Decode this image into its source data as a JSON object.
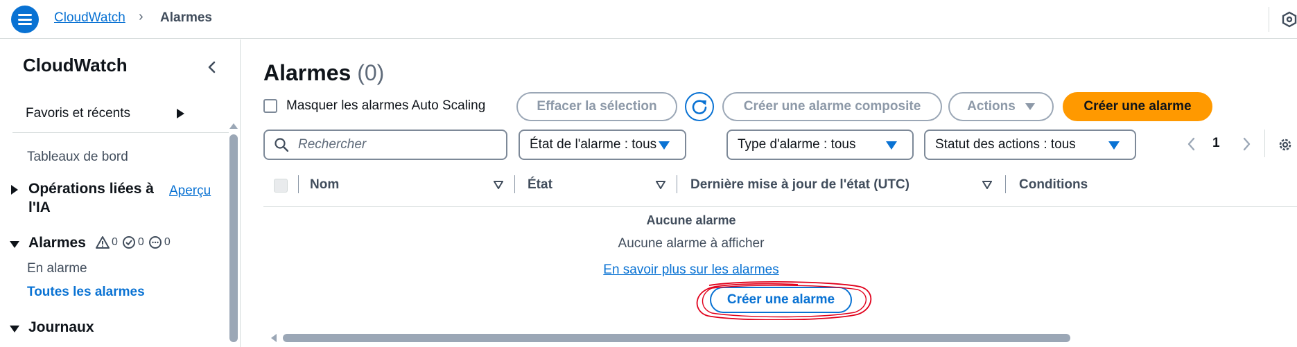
{
  "header": {
    "breadcrumb_service": "CloudWatch",
    "breadcrumb_current": "Alarmes"
  },
  "sidebar": {
    "title": "CloudWatch",
    "favorites": "Favoris et récents",
    "dashboards": "Tableaux de bord",
    "ai_ops_line1": "Opérations liées à",
    "ai_ops_line2": "l'IA",
    "ai_ops_link": "Aperçu",
    "alarms": "Alarmes",
    "alarm_counts": {
      "in_alarm": "0",
      "ok": "0",
      "insufficient": "0"
    },
    "in_alarm": "En alarme",
    "all_alarms": "Toutes les alarmes",
    "logs": "Journaux"
  },
  "main": {
    "title": "Alarmes",
    "count": "(0)",
    "hide_autoscaling": "Masquer les alarmes Auto Scaling",
    "clear_selection": "Effacer la sélection",
    "create_composite": "Créer une alarme composite",
    "actions": "Actions",
    "create_alarm": "Créer une alarme",
    "search_placeholder": "Rechercher",
    "filter_state": "État de l'alarme : tous",
    "filter_type": "Type d'alarme : tous",
    "filter_actions": "Statut des actions : tous",
    "page": "1"
  },
  "table": {
    "columns": [
      "Nom",
      "État",
      "Dernière mise à jour de l'état (UTC)",
      "Conditions"
    ],
    "empty_title": "Aucune alarme",
    "empty_sub": "Aucune alarme à afficher",
    "learn_more": "En savoir plus sur les alarmes",
    "create_alarm": "Créer une alarme"
  },
  "colors": {
    "primary": "#0972d3",
    "accent": "#ff9900",
    "annotation": "#e0001b"
  }
}
